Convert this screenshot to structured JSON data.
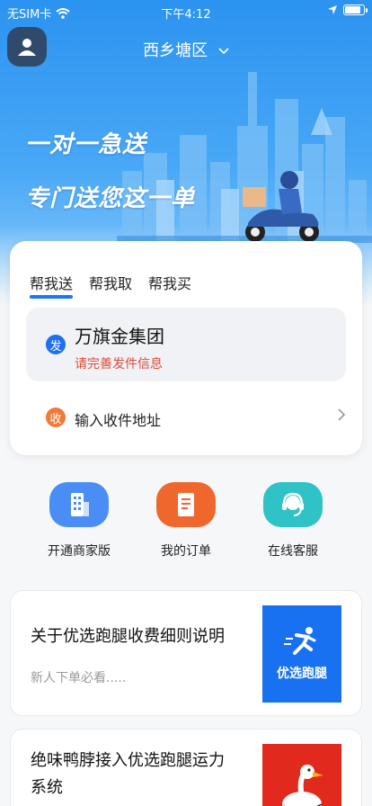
{
  "status_bar": {
    "carrier": "无SIM卡",
    "time": "下午4:12",
    "battery_level": 0.9
  },
  "header": {
    "location": "西乡塘区"
  },
  "hero": {
    "slogan_line1": "一对一急送",
    "slogan_line2": "专门送您这一单"
  },
  "order_card": {
    "tabs": [
      {
        "label": "帮我送",
        "active": true
      },
      {
        "label": "帮我取",
        "active": false
      },
      {
        "label": "帮我买",
        "active": false
      }
    ],
    "sender": {
      "badge": "发",
      "name": "万旗金集团",
      "hint": "请完善发件信息"
    },
    "receiver": {
      "badge": "收",
      "label": "输入收件地址"
    }
  },
  "actions": [
    {
      "label": "开通商家版",
      "icon": "building-icon",
      "color": "#4a8ef5"
    },
    {
      "label": "我的订单",
      "icon": "receipt-icon",
      "color": "#f0672e"
    },
    {
      "label": "在线客服",
      "icon": "headset-icon",
      "color": "#2fc2c6"
    }
  ],
  "news": [
    {
      "title": "关于优选跑腿收费细则说明",
      "subtitle": "新人下单必看.....",
      "thumb_text": "优选跑腿",
      "thumb_icon": "runner-icon"
    },
    {
      "title": "绝味鸭脖接入优选跑腿运力系统",
      "subtitle": "",
      "thumb_icon": "duck-logo-icon"
    }
  ],
  "colors": {
    "accent": "#1677ff",
    "hint_red": "#e04a3a",
    "receiver_orange": "#f07a38"
  }
}
